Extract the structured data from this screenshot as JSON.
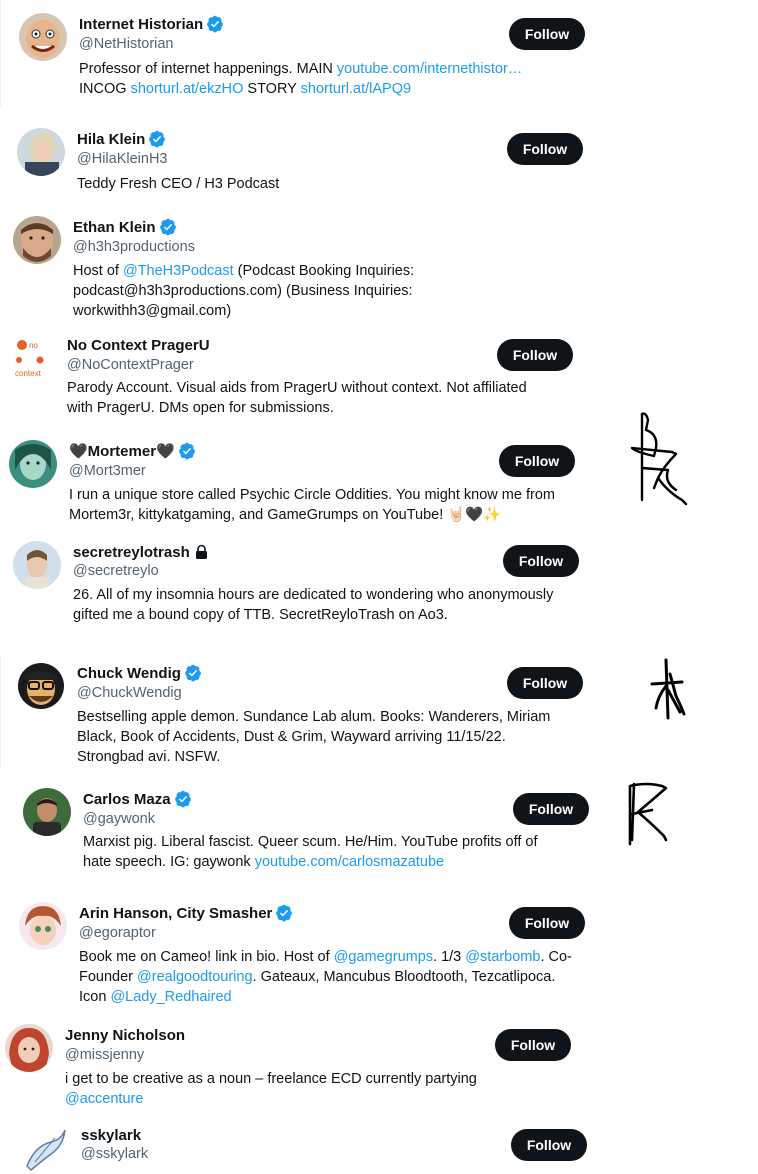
{
  "follow_label": "Follow",
  "colors": {
    "link": "#1d9bf0",
    "verified": "#1d9bf0",
    "button": "#0f1419",
    "handle": "#536471"
  },
  "accounts": [
    {
      "name": "Internet Historian",
      "verified": true,
      "handle": "@NetHistorian",
      "bio": [
        {
          "t": "Professor of internet happenings. MAIN ",
          "l": "youtube.com/internethistor…"
        },
        {
          "l1": "INCOG ",
          "a": "shorturl.at/ekzHO",
          "m": " STORY ",
          "b": "shorturl.at/lAPQ9"
        }
      ]
    },
    {
      "name": "Hila Klein",
      "verified": true,
      "handle": "@HilaKleinH3",
      "bio": [
        "Teddy Fresh CEO / H3 Podcast"
      ]
    },
    {
      "name": "Ethan Klein",
      "verified": true,
      "handle": "@h3h3productions",
      "bio": [
        {
          "t": "Host of ",
          "l": "@TheH3Podcast",
          "r": " (Podcast Booking Inquiries:"
        },
        "podcast@h3h3productions.com) (Business Inquiries:",
        "workwithh3@gmail.com)"
      ]
    },
    {
      "name": "No Context PragerU",
      "verified": false,
      "handle": "@NoContextPrager",
      "avatar_text": [
        "no",
        "context"
      ],
      "bio": [
        "Parody Account. Visual aids from PragerU without context. Not affiliated",
        "with PragerU. DMs open for submissions."
      ]
    },
    {
      "name": "🖤Mortemer🖤",
      "verified": true,
      "handle": "@Mort3mer",
      "bio": [
        "I run a unique store called Psychic Circle Oddities. You might know me from",
        "Mortem3r, kittykatgaming, and GameGrumps on YouTube! 🤘🏻🖤✨"
      ]
    },
    {
      "name": "secretreylotrash",
      "verified": false,
      "locked": true,
      "handle": "@secretreylo",
      "bio": [
        "26. All of my insomnia hours are dedicated to wondering who anonymously",
        "gifted me a bound copy of TTB. SecretReyloTrash on Ao3."
      ]
    },
    {
      "name": "Chuck Wendig",
      "verified": true,
      "handle": "@ChuckWendig",
      "bio": [
        "Bestselling apple demon. Sundance Lab alum. Books: Wanderers, Miriam",
        "Black, Book of Accidents, Dust & Grim, Wayward arriving 11/15/22.",
        "Strongbad avi. NSFW."
      ]
    },
    {
      "name": "Carlos Maza",
      "verified": true,
      "handle": "@gaywonk",
      "bio": [
        "Marxist pig. Liberal fascist. Queer scum. He/Him. YouTube profits off of",
        {
          "t": "hate speech. IG: gaywonk ",
          "l": "youtube.com/carlosmazatube"
        }
      ]
    },
    {
      "name": "Arin Hanson, City Smasher",
      "verified": true,
      "handle": "@egoraptor",
      "bio": [
        {
          "t": "Book me on Cameo! link in bio. Host of ",
          "l": "@gamegrumps",
          "r": ". 1/3 ",
          "l2": "@starbomb",
          "r2": ". Co-"
        },
        {
          "t": "Founder ",
          "l": "@realgoodtouring",
          "r": ". Gateaux, Mancubus Bloodtooth, Tezcatlipoca."
        },
        {
          "t": "Icon ",
          "l": "@Lady_Redhaired"
        }
      ]
    },
    {
      "name": "Jenny Nicholson",
      "verified": false,
      "handle": "@missjenny",
      "bio": [
        "i get to be creative as a noun – freelance ECD currently partying",
        {
          "l": "@accenture"
        }
      ]
    },
    {
      "name": "sskylark",
      "verified": false,
      "handle": "@sskylark",
      "bio": []
    }
  ]
}
